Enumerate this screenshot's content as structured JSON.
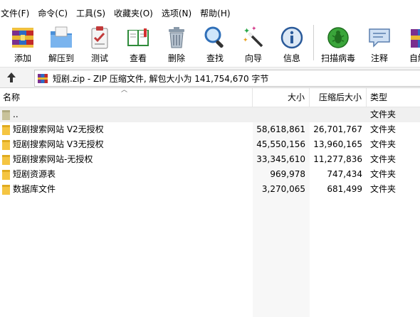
{
  "menu": [
    "文件(F)",
    "命令(C)",
    "工具(S)",
    "收藏夹(O)",
    "选项(N)",
    "帮助(H)"
  ],
  "toolbar": [
    {
      "label": "添加",
      "icon": "add-archive-icon"
    },
    {
      "label": "解压到",
      "icon": "extract-folder-icon"
    },
    {
      "label": "测试",
      "icon": "test-clipboard-icon"
    },
    {
      "label": "查看",
      "icon": "view-book-icon"
    },
    {
      "label": "删除",
      "icon": "trash-icon"
    },
    {
      "label": "查找",
      "icon": "magnifier-icon"
    },
    {
      "label": "向导",
      "icon": "wizard-wand-icon"
    },
    {
      "label": "信息",
      "icon": "info-icon"
    },
    {
      "label": "扫描病毒",
      "icon": "virus-scan-icon"
    },
    {
      "label": "注释",
      "icon": "comment-icon"
    },
    {
      "label": "自解",
      "icon": "sfx-icon"
    }
  ],
  "address": {
    "text": "短剧.zip - ZIP 压缩文件, 解包大小为 141,754,670 字节"
  },
  "columns": {
    "name": "名称",
    "size": "大小",
    "packed": "压缩后大小",
    "type": "类型"
  },
  "files": [
    {
      "name": "..",
      "size": "",
      "packed": "",
      "type": "文件夹",
      "parent": true
    },
    {
      "name": "短剧搜索网站 V2无授权",
      "size": "58,618,861",
      "packed": "26,701,767",
      "type": "文件夹"
    },
    {
      "name": "短剧搜索网站 V3无授权",
      "size": "45,550,156",
      "packed": "13,960,165",
      "type": "文件夹"
    },
    {
      "name": "短剧搜索网站-无授权",
      "size": "33,345,610",
      "packed": "11,277,836",
      "type": "文件夹"
    },
    {
      "name": "短剧资源表",
      "size": "969,978",
      "packed": "747,434",
      "type": "文件夹"
    },
    {
      "name": "数据库文件",
      "size": "3,270,065",
      "packed": "681,499",
      "type": "文件夹"
    }
  ]
}
